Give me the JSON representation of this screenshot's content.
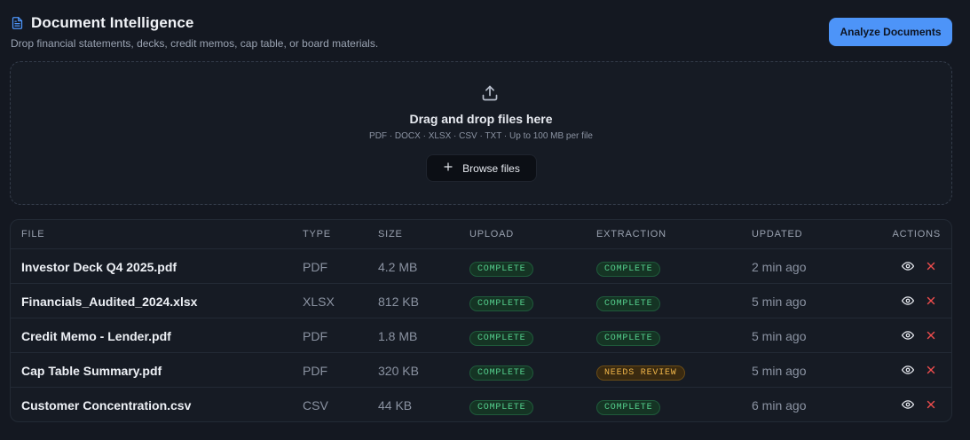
{
  "header": {
    "title": "Document Intelligence",
    "subtitle": "Drop financial statements, decks, credit memos, cap table, or board materials.",
    "analyze_label": "Analyze Documents"
  },
  "dropzone": {
    "title": "Drag and drop files here",
    "hint": "PDF · DOCX · XLSX · CSV · TXT  ·  Up to 100 MB per file",
    "browse_label": "Browse files"
  },
  "table": {
    "columns": [
      "File",
      "Type",
      "Size",
      "Upload",
      "Extraction",
      "Updated",
      "Actions"
    ],
    "rows": [
      {
        "file": "Investor Deck Q4 2025.pdf",
        "type": "PDF",
        "size": "4.2 MB",
        "upload": "COMPLETE",
        "extraction": "COMPLETE",
        "updated": "2 min ago"
      },
      {
        "file": "Financials_Audited_2024.xlsx",
        "type": "XLSX",
        "size": "812 KB",
        "upload": "COMPLETE",
        "extraction": "COMPLETE",
        "updated": "5 min ago"
      },
      {
        "file": "Credit Memo - Lender.pdf",
        "type": "PDF",
        "size": "1.8 MB",
        "upload": "COMPLETE",
        "extraction": "COMPLETE",
        "updated": "5 min ago"
      },
      {
        "file": "Cap Table Summary.pdf",
        "type": "PDF",
        "size": "320 KB",
        "upload": "COMPLETE",
        "extraction": "NEEDS REVIEW",
        "updated": "5 min ago"
      },
      {
        "file": "Customer Concentration.csv",
        "type": "CSV",
        "size": "44 KB",
        "upload": "COMPLETE",
        "extraction": "COMPLETE",
        "updated": "6 min ago"
      }
    ]
  },
  "icons": {
    "header": "document-icon",
    "upload": "upload-icon",
    "browse": "plus-icon",
    "view": "eye-icon",
    "remove": "close-icon"
  },
  "colors": {
    "accent": "#4d94f8",
    "complete": "#55d08e",
    "needs_review": "#f0b64a",
    "danger": "#ef4d4d"
  }
}
